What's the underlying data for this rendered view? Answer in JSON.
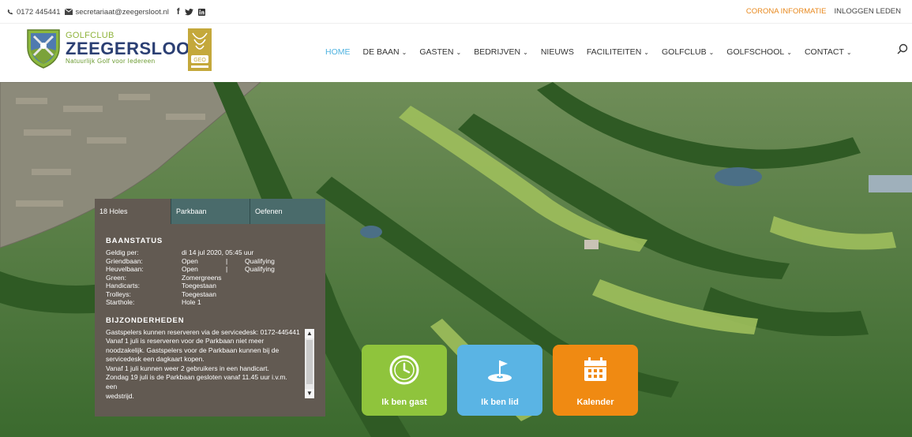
{
  "topbar": {
    "phone": "0172 445441",
    "email": "secretariaat@zeegersloot.nl",
    "corona": "CORONA INFORMATIE",
    "login": "INLOGGEN LEDEN"
  },
  "logo": {
    "small": "GOLFCLUB",
    "big": "ZEEGERSLOOT",
    "tagline": "Natuurlijk Golf voor Iedereen"
  },
  "nav": {
    "home": "HOME",
    "debaan": "DE BAAN",
    "gasten": "GASTEN",
    "bedrijven": "BEDRIJVEN",
    "nieuws": "NIEUWS",
    "faciliteiten": "FACILITEITEN",
    "golfclub": "GOLFCLUB",
    "golfschool": "GOLFSCHOOL",
    "contact": "CONTACT"
  },
  "panel": {
    "tabs": [
      "18 Holes",
      "Parkbaan",
      "Oefenen"
    ],
    "status_title": "BAANSTATUS",
    "rows": [
      {
        "k": "Geldig per:",
        "v1": "di 14 jul 2020, 05:45 uur",
        "sep": "",
        "v2": ""
      },
      {
        "k": "Griendbaan:",
        "v1": "Open",
        "sep": "|",
        "v2": "Qualifying"
      },
      {
        "k": "Heuvelbaan:",
        "v1": "Open",
        "sep": "|",
        "v2": "Qualifying"
      },
      {
        "k": "Green:",
        "v1": "Zomergreens",
        "sep": "",
        "v2": ""
      },
      {
        "k": "Handicarts:",
        "v1": "Toegestaan",
        "sep": "",
        "v2": ""
      },
      {
        "k": "Trolleys:",
        "v1": "Toegestaan",
        "sep": "",
        "v2": ""
      },
      {
        "k": "Starthole:",
        "v1": "Hole 1",
        "sep": "",
        "v2": ""
      }
    ],
    "notes_title": "BIJZONDERHEDEN",
    "notes": [
      "Gastspelers kunnen reserveren via de servicedesk: 0172-445441",
      "Vanaf 1 juli is reserveren voor de Parkbaan niet meer",
      "noodzakelijk. Gastspelers voor de Parkbaan kunnen bij de",
      "servicedesk een dagkaart kopen.",
      "Vanaf 1 juli kunnen weer 2 gebruikers in een handicart.",
      "Zondag 19 juli is de Parkbaan gesloten vanaf 11.45 uur i.v.m. een",
      "wedstrijd."
    ]
  },
  "tiles": {
    "guest": "Ik ben gast",
    "member": "Ik ben lid",
    "calendar": "Kalender"
  },
  "colors": {
    "accent_blue": "#4fb3e0",
    "orange": "#f08a12",
    "green": "#8fc43c",
    "navy": "#2b3f73"
  }
}
